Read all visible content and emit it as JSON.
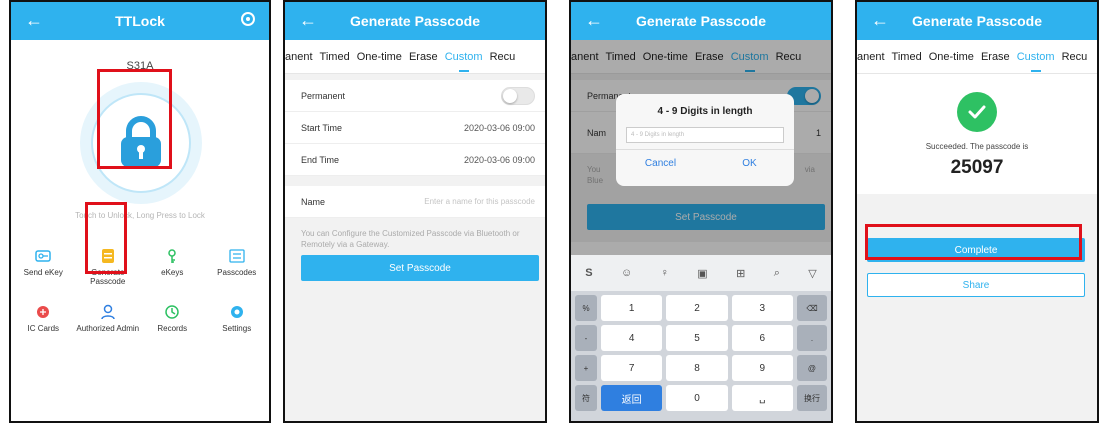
{
  "screen1": {
    "title": "TTLock",
    "lock_name": "S31A",
    "hint": "Touch to Unlock, Long Press to Lock",
    "menu": [
      {
        "label": "Send eKey",
        "icon": "send-ekey-icon"
      },
      {
        "label": "Generate Passcode",
        "icon": "generate-passcode-icon"
      },
      {
        "label": "eKeys",
        "icon": "ekeys-icon"
      },
      {
        "label": "Passcodes",
        "icon": "passcodes-icon"
      },
      {
        "label": "IC Cards",
        "icon": "ic-cards-icon"
      },
      {
        "label": "Authorized Admin",
        "icon": "authorized-admin-icon"
      },
      {
        "label": "Records",
        "icon": "records-icon"
      },
      {
        "label": "Settings",
        "icon": "settings-icon"
      }
    ]
  },
  "screen2": {
    "title": "Generate Passcode",
    "tabs": [
      "anent",
      "Timed",
      "One-time",
      "Erase",
      "Custom",
      "Recu"
    ],
    "permanent_label": "Permanent",
    "permanent_on": false,
    "start_label": "Start Time",
    "start_value": "2020-03-06 09:00",
    "end_label": "End Time",
    "end_value": "2020-03-06 09:00",
    "name_label": "Name",
    "name_placeholder": "Enter a name for this passcode",
    "info": "You can Configure the Customized Passcode via Bluetooth or Remotely via a Gateway.",
    "button": "Set Passcode"
  },
  "screen3": {
    "title": "Generate Passcode",
    "tabs": [
      "anent",
      "Timed",
      "One-time",
      "Erase",
      "Custom",
      "Recu"
    ],
    "permanent_label": "Permanent",
    "permanent_on": true,
    "name_label": "Nam",
    "bg_value": "1",
    "info_left": "You",
    "info_left2": "Blue",
    "info_right": "via",
    "dialog_title": "4 - 9 Digits in length",
    "dialog_placeholder": "4 - 9 Digits in length",
    "cancel": "Cancel",
    "ok": "OK",
    "button": "Set Passcode",
    "keys": [
      [
        "%",
        "1",
        "2",
        "3",
        "⌫"
      ],
      [
        "-",
        "4",
        "5",
        "6",
        "."
      ],
      [
        "+",
        "7",
        "8",
        "9",
        "@"
      ],
      [
        "符",
        "返回",
        "0",
        "␣",
        "换行"
      ]
    ]
  },
  "screen4": {
    "title": "Generate Passcode",
    "tabs": [
      "anent",
      "Timed",
      "One-time",
      "Erase",
      "Custom",
      "Recu"
    ],
    "success_text": "Succeeded. The passcode is",
    "passcode": "25097",
    "complete": "Complete",
    "share": "Share"
  },
  "colors": {
    "accent": "#2fb2ee",
    "highlight": "#e0101a",
    "success": "#2ec163"
  }
}
